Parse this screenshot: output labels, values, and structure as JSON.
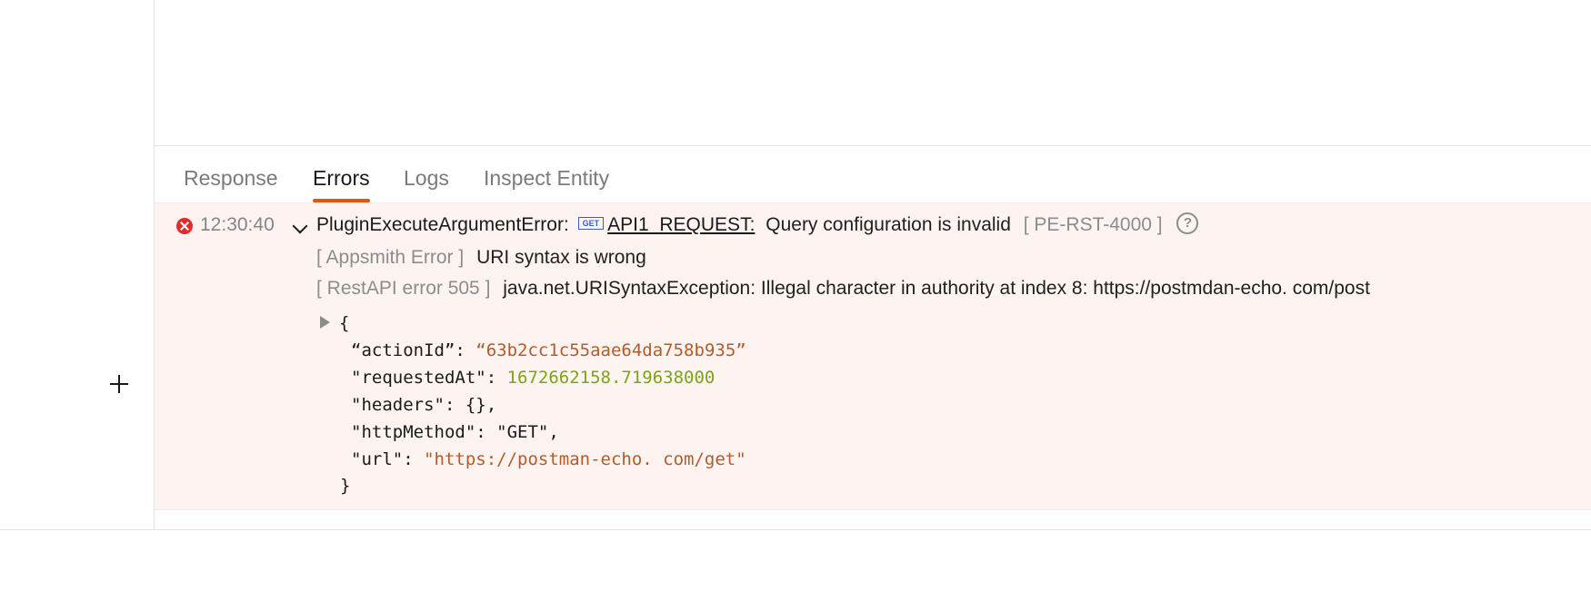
{
  "tabs": [
    {
      "label": "Response"
    },
    {
      "label": "Errors"
    },
    {
      "label": "Logs"
    },
    {
      "label": "Inspect Entity"
    }
  ],
  "active_tab": "Errors",
  "error": {
    "timestamp": "12:30:40",
    "type": "PluginExecuteArgumentError:",
    "method_badge": "GET",
    "api_name": "API1_REQUEST:",
    "message": "Query configuration is invalid",
    "code": "[ PE-RST-4000 ]",
    "help_glyph": "?",
    "details": [
      {
        "tag": "[ Appsmith Error ]",
        "text": "URI syntax is wrong"
      },
      {
        "tag": "[ RestAPI error 505 ]",
        "text": "java.net.URISyntaxException: Illegal character in authority at index 8: https://postmdan-echo. com/post"
      }
    ],
    "json": {
      "open": "{",
      "close": "}",
      "lines": [
        {
          "key": "“actionId”: ",
          "value": "“63b2cc1c55aae64da758b935”",
          "suffix": ""
        },
        {
          "key": "\"requestedAt\": ",
          "value": "1672662158.719638000",
          "suffix": ""
        },
        {
          "key": "\"headers\": {},",
          "value": "",
          "suffix": ""
        },
        {
          "key": "\"httpMethod\": \"GET\",",
          "value": "",
          "suffix": ""
        },
        {
          "key": "\"url\": ",
          "value": "\"https://postman-echo. com/get\"",
          "suffix": ""
        }
      ]
    }
  },
  "colors": {
    "accent": "#e15615",
    "error_bg": "#fdf4f2",
    "error_icon": "#e22c2c",
    "json_string": "#b35c29",
    "json_number": "#7ca31b"
  }
}
